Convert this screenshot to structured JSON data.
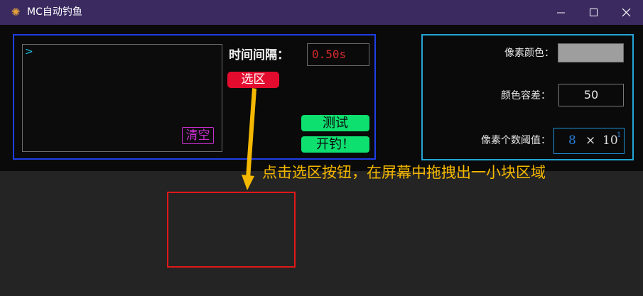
{
  "window": {
    "title": "MC自动钓鱼",
    "app_icon": "fish-bobber-icon"
  },
  "left_panel": {
    "prompt": ">",
    "clear_label": "清空",
    "interval_label": "时间间隔：",
    "interval_value": "0.50s",
    "select_label": "选区",
    "test_label": "测试",
    "fish_label": "开钓！"
  },
  "right_panel": {
    "pixel_color_label": "像素颜色：",
    "pixel_color_value": "#9e9e9e",
    "tolerance_label": "颜色容差：",
    "tolerance_value": "50",
    "threshold_label": "像素个数阈值：",
    "threshold_value": "8",
    "threshold_times": "×",
    "threshold_base": "10",
    "threshold_exp": "1"
  },
  "annotation": {
    "text": "点击选区按钮，在屏幕中拖拽出一小块区域"
  },
  "colors": {
    "titlebar": "#3a2a60",
    "left_border": "#1e3ee6",
    "right_border": "#23a6d6",
    "select_button": "#e40c2e",
    "action_buttons": "#0ee070",
    "annotation": "#f5b800",
    "selection_rect": "#e01818"
  }
}
